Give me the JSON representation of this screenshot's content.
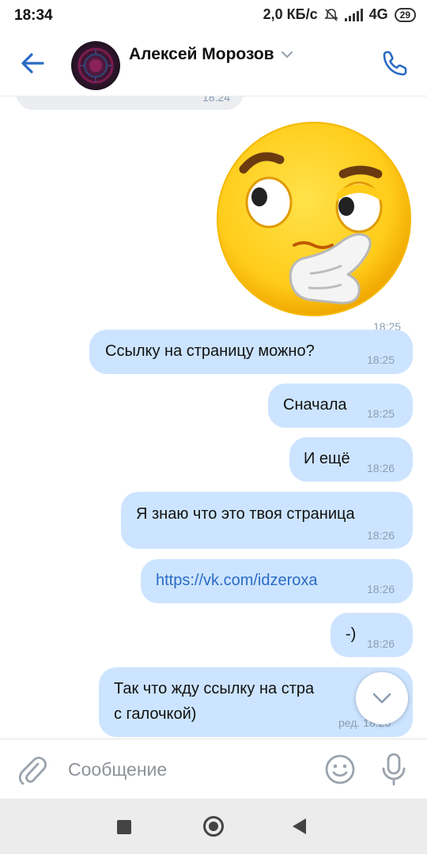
{
  "status_bar": {
    "time": "18:34",
    "net_speed": "2,0 КБ/с",
    "network": "4G",
    "battery": "29"
  },
  "header": {
    "contact_name": "Алексей Морозов"
  },
  "feed": {
    "partial_incoming_time": "18:24",
    "sticker_time": "18:25",
    "messages": [
      {
        "text": "Ссылку на страницу можно?",
        "time": "18:25"
      },
      {
        "text": "Сначала",
        "time": "18:25"
      },
      {
        "text": "И ещё",
        "time": "18:26"
      },
      {
        "text": "Я знаю что это твоя страница",
        "time": "18:26"
      },
      {
        "text": "https://vk.com/idzeroxa",
        "time": "18:26"
      },
      {
        "text": "-)",
        "time": "18:26"
      },
      {
        "text_line1": "Так что жду ссылку на стра",
        "text_line2": "с галочкой)",
        "time": "ред. 18:26"
      }
    ]
  },
  "composer": {
    "placeholder": "Сообщение"
  },
  "icons": {
    "back": "arrow-left-icon",
    "call": "phone-icon",
    "attach": "paperclip-icon",
    "emoji": "smiley-icon",
    "mic": "microphone-icon",
    "scroll": "chevron-down-icon"
  },
  "colors": {
    "accent": "#2a6bc4",
    "outgoing_bubble": "#cce4ff",
    "incoming_bubble": "#ebedf0",
    "time_text": "#8a9db3"
  }
}
